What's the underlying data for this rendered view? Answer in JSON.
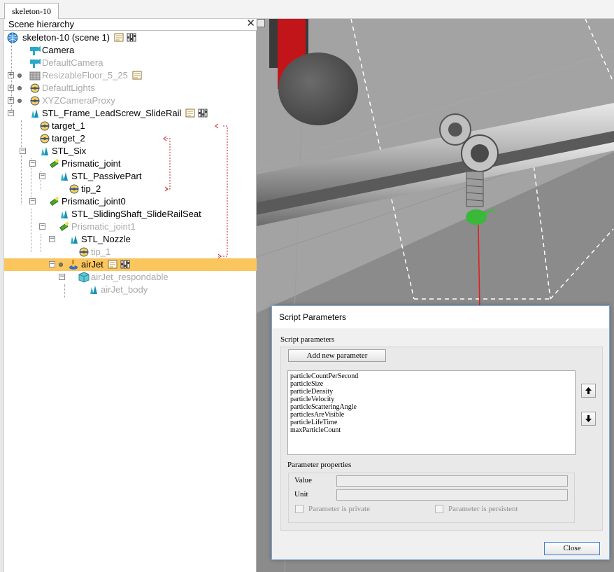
{
  "tabs": {
    "active": "skeleton-10"
  },
  "hierarchy": {
    "title": "Scene hierarchy",
    "close_glyph": "✕",
    "items": [
      {
        "label": "skeleton-10 (scene 1)",
        "icon": "globe-icon",
        "state": "normal",
        "badges": [
          "script-icon",
          "settings-icon"
        ]
      },
      {
        "label": "Camera",
        "icon": "camera-icon",
        "state": "normal"
      },
      {
        "label": "DefaultCamera",
        "icon": "camera-icon",
        "state": "dim"
      },
      {
        "label": "ResizableFloor_5_25",
        "icon": "floor-icon",
        "state": "dim",
        "badges": [
          "script-icon"
        ]
      },
      {
        "label": "DefaultLights",
        "icon": "dummy-icon",
        "state": "dim"
      },
      {
        "label": "XYZCameraProxy",
        "icon": "dummy-icon",
        "state": "dim"
      },
      {
        "label": "STL_Frame_LeadScrew_SlideRail",
        "icon": "shape-icon",
        "state": "normal",
        "badges": [
          "script-icon",
          "settings-icon"
        ]
      },
      {
        "label": "target_1",
        "icon": "dummy-icon",
        "state": "normal"
      },
      {
        "label": "target_2",
        "icon": "dummy-icon",
        "state": "normal"
      },
      {
        "label": "STL_Six",
        "icon": "shape-icon",
        "state": "normal"
      },
      {
        "label": "Prismatic_joint",
        "icon": "joint-icon",
        "state": "normal"
      },
      {
        "label": "STL_PassivePart",
        "icon": "shape-icon",
        "state": "normal"
      },
      {
        "label": "tip_2",
        "icon": "dummy-icon",
        "state": "normal"
      },
      {
        "label": "Prismatic_joint0",
        "icon": "joint-icon",
        "state": "normal"
      },
      {
        "label": "STL_SlidingShaft_SlideRailSeat",
        "icon": "shape-icon",
        "state": "normal"
      },
      {
        "label": "Prismatic_joint1",
        "icon": "joint-icon",
        "state": "dim"
      },
      {
        "label": "STL_Nozzle",
        "icon": "shape-icon",
        "state": "normal"
      },
      {
        "label": "tip_1",
        "icon": "dummy-icon",
        "state": "dim"
      },
      {
        "label": "airJet",
        "icon": "force-sensor-icon",
        "state": "selected",
        "badges": [
          "script-icon",
          "settings-icon"
        ]
      },
      {
        "label": "airJet_respondable",
        "icon": "cube-icon",
        "state": "dim"
      },
      {
        "label": "airJet_body",
        "icon": "shape-icon",
        "state": "dim"
      }
    ]
  },
  "dialog": {
    "title": "Script Parameters",
    "group_label": "Script parameters",
    "add_button": "Add new parameter",
    "parameters": [
      "particleCountPerSecond",
      "particleSize",
      "particleDensity",
      "particleVelocity",
      "particleScatteringAngle",
      "particlesAreVisible",
      "particleLifeTime",
      "maxParticleCount"
    ],
    "up_glyph": "🠕",
    "down_glyph": "🠗",
    "properties_label": "Parameter properties",
    "value_label": "Value",
    "unit_label": "Unit",
    "value": "",
    "unit": "",
    "private_label": "Parameter is private",
    "persistent_label": "Parameter is persistent",
    "close_button": "Close"
  },
  "colors": {
    "selection": "#fbc65e",
    "dim_text": "#a9a9a9",
    "link_arrow": "#cc2222"
  }
}
